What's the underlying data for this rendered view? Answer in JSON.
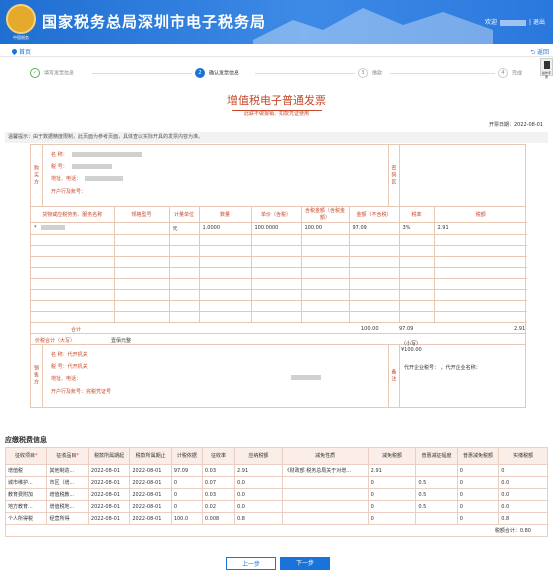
{
  "header": {
    "logo_text": "中国税务",
    "site_title": "国家税务总局深圳市电子税务局",
    "welcome": "欢迎",
    "logout": "退出"
  },
  "breadcrumb": {
    "home": "首页"
  },
  "toolbar": {
    "back": "返回",
    "manual": "操作手册"
  },
  "steps": [
    {
      "num": "✓",
      "label": "填写发票信息"
    },
    {
      "num": "2",
      "label": "确认发票信息"
    },
    {
      "num": "3",
      "label": "缴款"
    },
    {
      "num": "4",
      "label": "完成"
    }
  ],
  "invoice": {
    "title": "增值税电子普通发票",
    "subtitle": "此联不做报销、扣款凭证使用",
    "issue_date": "开票日期：2022-08-01",
    "tip": "温馨提示：由于数据精度限制，此页面为参考页面，具体查以实际开具的发票内容为准。",
    "buyer_label": "购买方",
    "buyer_fields": {
      "name": "名        称：",
      "taxid": "税        号：",
      "addr": "地址、电话：",
      "bank": "开户行及账号："
    },
    "code_label": "密码区",
    "item_headers": [
      "货物或应税劳务、服务名称",
      "规格型号",
      "计量单位",
      "数量",
      "单价（含税）",
      "含税金额（含税金额）",
      "金额（不含税）",
      "税率",
      "税额"
    ],
    "items": [
      {
        "name": "*",
        "spec": "",
        "unit": "元",
        "qty": "1.0000",
        "price": "100.0000",
        "gross": "100.00",
        "net": "97.09",
        "rate": "3%",
        "tax": "2.91"
      }
    ],
    "total_label": "合计",
    "total_gross": "100.00",
    "total_net": "97.09",
    "total_tax": "2.91",
    "grand_label": "价税合计（大写）",
    "grand_upper": "壹佰元整",
    "grand_lower": "（小写）¥100.00",
    "seller_label": "销售方",
    "seller_fields": {
      "name": "名        称：代开机关",
      "taxid": "税        号：代开机关",
      "addr": "地址、电话：",
      "bank": "开户行及账号：完税凭证号"
    },
    "remark_label": "备注",
    "remark_text": "代开企业税号：              ，代开企业名称："
  },
  "tax_section": {
    "title": "应缴税费信息",
    "headers": [
      "征收项目",
      "征收品目",
      "税款所属期起",
      "税款所属期止",
      "计税依据",
      "征收率",
      "应纳税额",
      "减免性质",
      "减免税额",
      "普惠减征幅度",
      "普惠减免税额",
      "实缴税额"
    ],
    "rows": [
      [
        "增值税",
        "其他制造...",
        "2022-08-01",
        "2022-08-01",
        "97.09",
        "0.03",
        "2.91",
        "《财政部 税务总局关于对增...",
        "2.91",
        "",
        "0",
        "0"
      ],
      [
        "城市维护...",
        "市区（增...",
        "2022-08-01",
        "2022-08-01",
        "0",
        "0.07",
        "0.0",
        "",
        "0",
        "0.5",
        "0",
        "0.0"
      ],
      [
        "教育费附加",
        "增值税教...",
        "2022-08-01",
        "2022-08-01",
        "0",
        "0.03",
        "0.0",
        "",
        "0",
        "0.5",
        "0",
        "0.0"
      ],
      [
        "地方教育...",
        "增值税地...",
        "2022-08-01",
        "2022-08-01",
        "0",
        "0.02",
        "0.0",
        "",
        "0",
        "0.5",
        "0",
        "0.0"
      ],
      [
        "个人所得税",
        "经营所得",
        "2022-08-01",
        "2022-08-01",
        "100.0",
        "0.008",
        "0.8",
        "",
        "0",
        "",
        "0",
        "0.8"
      ]
    ],
    "total": "税额合计：0.80"
  },
  "buttons": {
    "prev": "上一步",
    "next": "下一步"
  }
}
